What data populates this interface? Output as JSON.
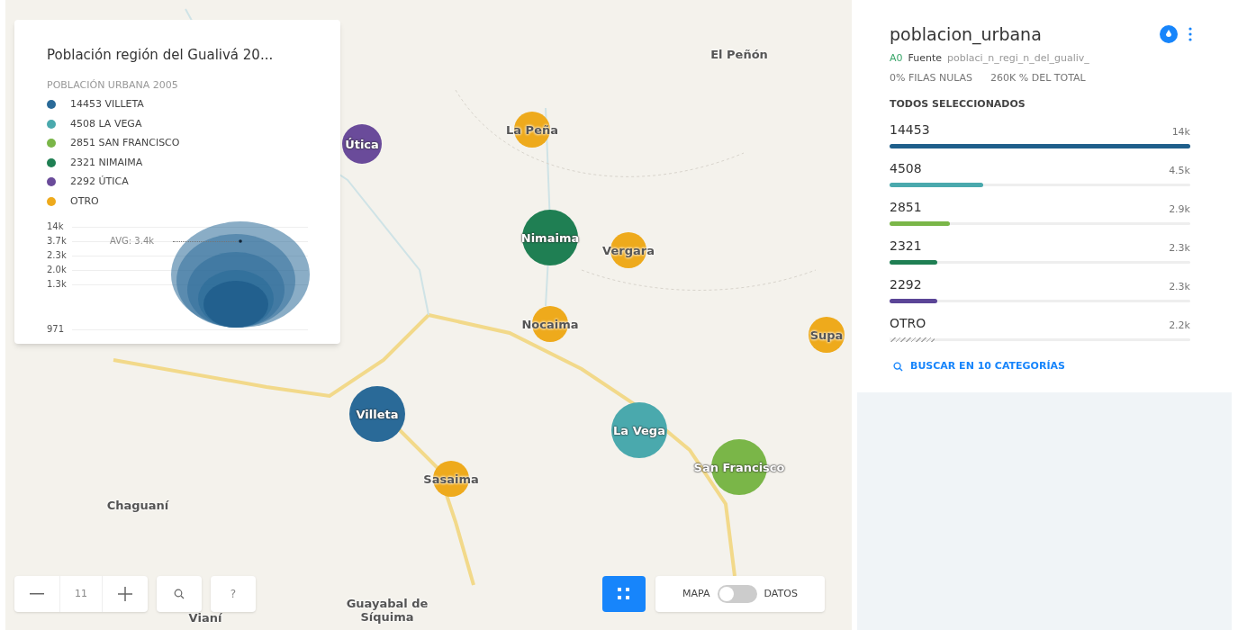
{
  "legend": {
    "title": "Población región del Gualivá 20...",
    "subtitle": "POBLACIÓN URBANA 2005",
    "items": [
      {
        "label": "14453 VILLETA",
        "color": "#2a6a98"
      },
      {
        "label": "4508 LA VEGA",
        "color": "#4aa9ad"
      },
      {
        "label": "2851 SAN FRANCISCO",
        "color": "#7ab648"
      },
      {
        "label": "2321 NIMAIMA",
        "color": "#1f7f53"
      },
      {
        "label": "2292 ÚTICA",
        "color": "#6a4b9a"
      },
      {
        "label": "OTRO",
        "color": "#eeaa1c"
      }
    ],
    "ticks": [
      "14k",
      "3.7k",
      "2.3k",
      "2.0k",
      "1.3k",
      "971"
    ],
    "avg": "AVG: 3.4k"
  },
  "map": {
    "places": [
      {
        "name": "El Peñón",
        "kind": "plain"
      },
      {
        "name": "La Peña",
        "kind": "small",
        "color": "#eeaa1c"
      },
      {
        "name": "Útica",
        "kind": "medium",
        "color": "#6a4b9a"
      },
      {
        "name": "Nimaima",
        "kind": "large",
        "color": "#1f7f53"
      },
      {
        "name": "Vergara",
        "kind": "small",
        "color": "#eeaa1c"
      },
      {
        "name": "Nocaima",
        "kind": "small",
        "color": "#eeaa1c"
      },
      {
        "name": "Supa",
        "kind": "small",
        "color": "#eeaa1c"
      },
      {
        "name": "Villeta",
        "kind": "large",
        "color": "#2a6a98"
      },
      {
        "name": "La Vega",
        "kind": "large",
        "color": "#4aa9ad"
      },
      {
        "name": "San Francisco",
        "kind": "large",
        "color": "#7ab648"
      },
      {
        "name": "Sasaima",
        "kind": "small",
        "color": "#eeaa1c"
      },
      {
        "name": "Chaguaní",
        "kind": "plain"
      },
      {
        "name": "Vianí",
        "kind": "plain"
      },
      {
        "name": "Guayabal de Síquima",
        "kind": "plain"
      }
    ],
    "zoom": "11",
    "help": "?",
    "toggle": {
      "left": "MAPA",
      "right": "DATOS",
      "on": false
    }
  },
  "widget": {
    "title": "poblacion_urbana",
    "source_id": "A0",
    "source_label": "Fuente",
    "source": "poblaci_n_regi_n_del_gualiv_",
    "nulls": "0% FILAS NULAS",
    "total": "260K % DEL TOTAL",
    "selection": "TODOS SELECCIONADOS",
    "categories": [
      {
        "name": "14453",
        "value": "14k",
        "level": 1,
        "color": "#1f5f8b",
        "hatched": false
      },
      {
        "name": "4508",
        "value": "4.5k",
        "level": 0.31,
        "color": "#4aa9ad",
        "hatched": false
      },
      {
        "name": "2851",
        "value": "2.9k",
        "level": 0.2,
        "color": "#7ab648",
        "hatched": false
      },
      {
        "name": "2321",
        "value": "2.3k",
        "level": 0.16,
        "color": "#1f7f53",
        "hatched": false
      },
      {
        "name": "2292",
        "value": "2.3k",
        "level": 0.16,
        "color": "#5b4597",
        "hatched": false
      },
      {
        "name": "OTRO",
        "value": "2.2k",
        "level": 0.15,
        "color": "#aaaaaa",
        "hatched": true
      }
    ],
    "search": "BUSCAR EN 10 CATEGORÍAS"
  }
}
